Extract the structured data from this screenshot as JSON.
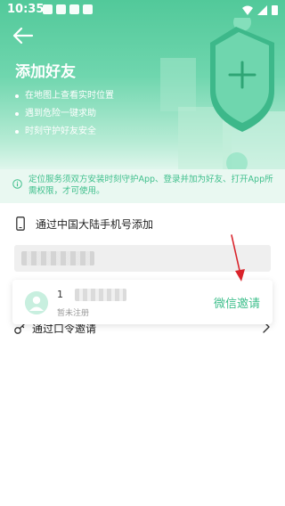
{
  "status_bar": {
    "time": "10:35"
  },
  "header": {
    "title": "添加好友",
    "features": [
      "在地图上查看实时位置",
      "遇到危险一键求助",
      "时刻守护好友安全"
    ]
  },
  "notice": {
    "text": "定位服务须双方安装时刻守护App、登录并加为好友、打开App所需权限，才可使用。"
  },
  "phone_section": {
    "label": "通过中国大陆手机号添加",
    "input_value": ""
  },
  "token_section": {
    "label": "通过口令邀请"
  },
  "result": {
    "number_prefix": "1",
    "status": "暂未注册",
    "invite_label": "微信邀请"
  },
  "colors": {
    "accent": "#3fbf8c",
    "arrow": "#d9232b"
  },
  "icons": {
    "back": "arrow-left-icon",
    "notice": "info-icon",
    "phone": "phone-icon",
    "token": "key-icon",
    "chevron": "chevron-right-icon",
    "avatar": "default-avatar"
  }
}
